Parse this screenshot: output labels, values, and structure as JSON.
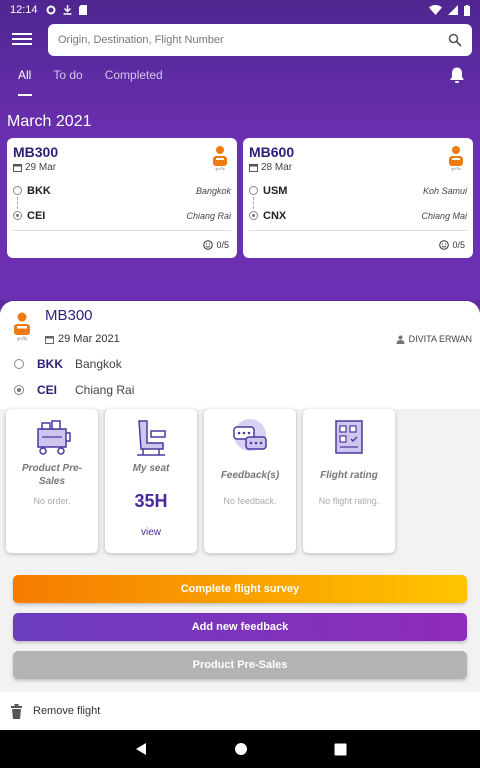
{
  "status_bar": {
    "time": "12:14"
  },
  "search": {
    "placeholder": "Origin, Destination, Flight Number"
  },
  "tabs": [
    {
      "label": "All",
      "active": true
    },
    {
      "label": "To do"
    },
    {
      "label": "Completed"
    }
  ],
  "month_header": "March 2021",
  "flight_cards": [
    {
      "code": "MB300",
      "date": "29 Mar",
      "origin_code": "BKK",
      "origin_city": "Bangkok",
      "dest_code": "CEI",
      "dest_city": "Chiang Rai",
      "score": "0/5"
    },
    {
      "code": "MB600",
      "date": "28 Mar",
      "origin_code": "USM",
      "origin_city": "Koh Samui",
      "dest_code": "CNX",
      "dest_city": "Chiang Mai",
      "score": "0/5"
    }
  ],
  "detail": {
    "code": "MB300",
    "date": "29 Mar 2021",
    "passenger": "DIVITA ERWAN",
    "origin_code": "BKK",
    "origin_city": "Bangkok",
    "dest_code": "CEI",
    "dest_city": "Chiang Rai",
    "tiles": {
      "presales": {
        "title": "Product Pre-Sales",
        "sub": "No order."
      },
      "seat": {
        "title": "My seat",
        "value": "35H",
        "link": "view"
      },
      "feedback": {
        "title": "Feedback(s)",
        "sub": "No feedback."
      },
      "rating": {
        "title": "Flight rating",
        "sub": "No flight rating."
      }
    }
  },
  "buttons": {
    "survey": "Complete flight survey",
    "feedback": "Add new feedback",
    "presales": "Product Pre-Sales"
  },
  "remove_label": "Remove flight",
  "colors": {
    "primary": "#5e2aa0",
    "orange_start": "#f57c00",
    "orange_end": "#ffc400",
    "purple_btn": "#7a34bd",
    "grey_btn": "#b3b3b3"
  }
}
